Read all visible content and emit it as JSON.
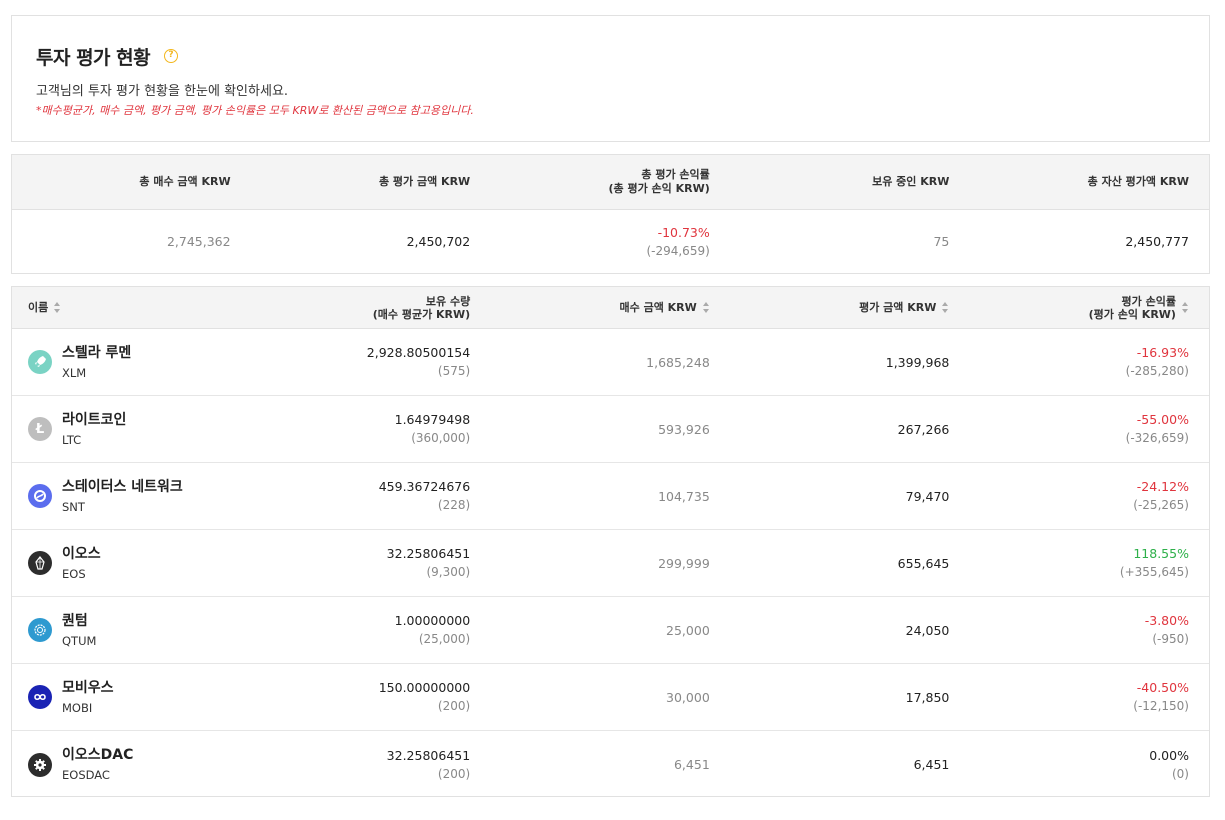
{
  "header": {
    "title": "투자 평가 현황",
    "help_icon": "?",
    "description": "고객님의 투자 평가 현황을 한눈에 확인하세요.",
    "note": "*매수평균가, 매수 금액, 평가 금액, 평가 손익률은 모두 KRW로 환산된 금액으로 참고용입니다."
  },
  "summary": {
    "headers": {
      "total_buy": "총 매수 금액 KRW",
      "total_eval": "총 평가 금액 KRW",
      "total_pnl_rate": "총 평가 손익률",
      "total_pnl_sub": "(총 평가 손익 KRW)",
      "krw_held": "보유 중인 KRW",
      "total_asset": "총 자산 평가액 KRW"
    },
    "values": {
      "total_buy": "2,745,362",
      "total_eval": "2,450,702",
      "total_pnl_rate": "-10.73%",
      "total_pnl": "(-294,659)",
      "krw_held": "75",
      "total_asset": "2,450,777"
    }
  },
  "table": {
    "headers": {
      "name": "이름",
      "qty": "보유 수량",
      "qty_sub": "(매수 평균가 KRW)",
      "buy_amount": "매수 금액 KRW",
      "eval_amount": "평가 금액 KRW",
      "pnl_rate": "평가 손익률",
      "pnl_sub": "(평가 손익 KRW)"
    },
    "rows": [
      {
        "name": "스텔라 루멘",
        "symbol": "XLM",
        "qty": "2,928.80500154",
        "avg": "(575)",
        "buy": "1,685,248",
        "eval": "1,399,968",
        "rate": "-16.93%",
        "pnl": "(-285,280)",
        "color": "#7ad3c4",
        "icon": "rocket"
      },
      {
        "name": "라이트코인",
        "symbol": "LTC",
        "qty": "1.64979498",
        "avg": "(360,000)",
        "buy": "593,926",
        "eval": "267,266",
        "rate": "-55.00%",
        "pnl": "(-326,659)",
        "color": "#bebebe",
        "icon": "Ł"
      },
      {
        "name": "스테이터스 네트워크",
        "symbol": "SNT",
        "qty": "459.36724676",
        "avg": "(228)",
        "buy": "104,735",
        "eval": "79,470",
        "rate": "-24.12%",
        "pnl": "(-25,265)",
        "color": "#5b6dee",
        "icon": "swirl"
      },
      {
        "name": "이오스",
        "symbol": "EOS",
        "qty": "32.25806451",
        "avg": "(9,300)",
        "buy": "299,999",
        "eval": "655,645",
        "rate": "118.55%",
        "pnl": "(+355,645)",
        "color": "#2d2d2d",
        "icon": "eos"
      },
      {
        "name": "퀀텀",
        "symbol": "QTUM",
        "qty": "1.00000000",
        "avg": "(25,000)",
        "buy": "25,000",
        "eval": "24,050",
        "rate": "-3.80%",
        "pnl": "(-950)",
        "color": "#2e9ad0",
        "icon": "qtum"
      },
      {
        "name": "모비우스",
        "symbol": "MOBI",
        "qty": "150.00000000",
        "avg": "(200)",
        "buy": "30,000",
        "eval": "17,850",
        "rate": "-40.50%",
        "pnl": "(-12,150)",
        "color": "#1a23b4",
        "icon": "infinity"
      },
      {
        "name": "이오스DAC",
        "symbol": "EOSDAC",
        "qty": "32.25806451",
        "avg": "(200)",
        "buy": "6,451",
        "eval": "6,451",
        "rate": "0.00%",
        "pnl": "(0)",
        "color": "#2d2d2d",
        "icon": "gear"
      }
    ]
  }
}
